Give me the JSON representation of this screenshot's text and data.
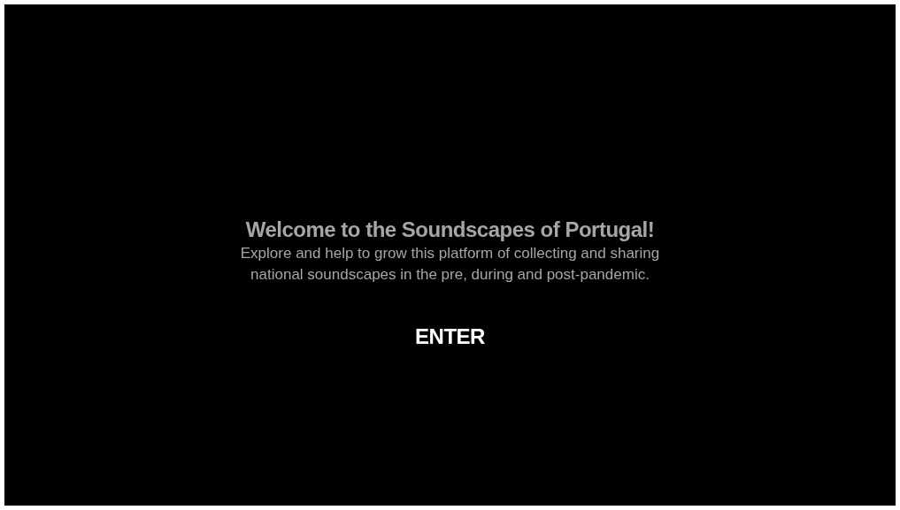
{
  "welcome": {
    "title": "Welcome to the Soundscapes of Portugal!",
    "description_lines": [
      "Explore and help to grow this platform of collecting and sharing",
      "national soundscapes in the pre, during and post-pandemic."
    ],
    "enter_button": "ENTER"
  }
}
